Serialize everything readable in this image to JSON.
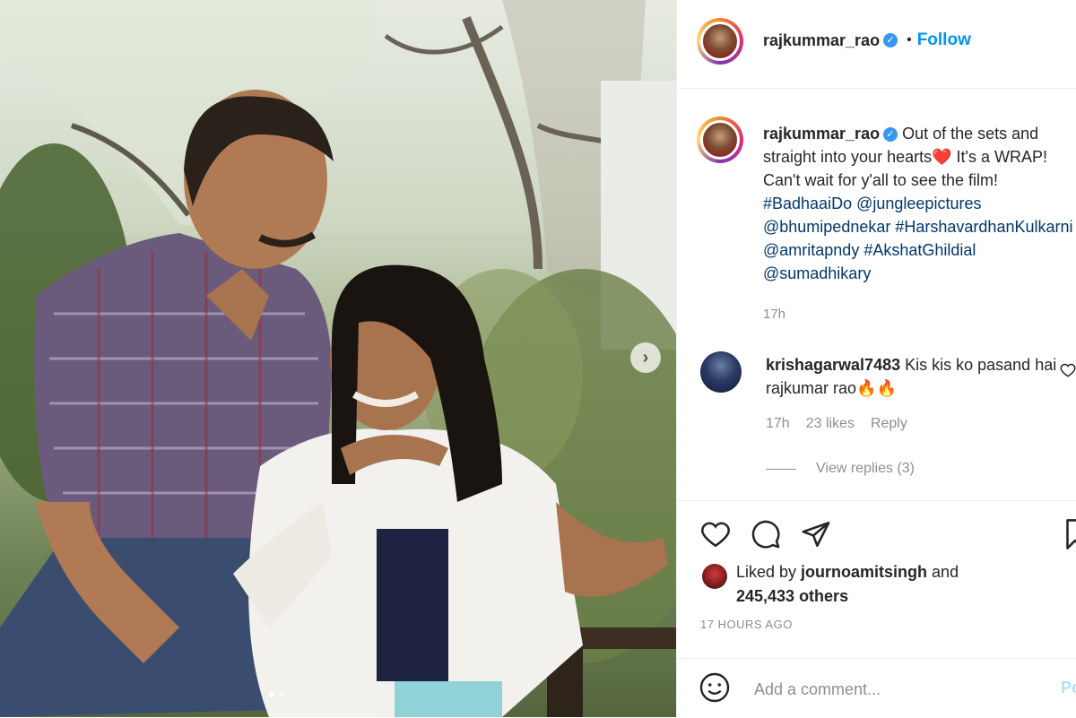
{
  "post": {
    "username": "rajkummar_rao",
    "verified_icon": "verified-badge-icon",
    "follow_label": "Follow",
    "separator": "•"
  },
  "caption": {
    "username": "rajkummar_rao",
    "text_1": "Out of the sets and straight into your hearts",
    "heart_emoji": "❤️",
    "text_2": " It's a WRAP! Can't wait for y'all to see the film! ",
    "hashtag_1": "#BadhaaiDo",
    "mention_1": "@jungleepictures",
    "mention_2": "@bhumipednekar",
    "hashtag_2": "#HarshavardhanKulkarni",
    "mention_3": "@amritapndy",
    "hashtag_3": "#AkshatGhildial",
    "mention_4": "@sumadhikary",
    "time": "17h"
  },
  "comment": {
    "username": "krishagarwal7483",
    "text": "Kis kis ko pasand hai rajkumar rao🔥🔥",
    "time": "17h",
    "likes": "23 likes",
    "reply_label": "Reply",
    "view_replies": "View replies (3)"
  },
  "likes": {
    "prefix": "Liked by ",
    "liker": "journoamitsingh",
    "middle": " and ",
    "count": "245,433 others"
  },
  "timestamp": "17 HOURS AGO",
  "add_comment": {
    "placeholder": "Add a comment...",
    "post_label": "Po"
  },
  "carousel": {
    "total_slides": 2,
    "current_slide": 1
  },
  "colors": {
    "link": "#00376b",
    "follow": "#0095f6",
    "verified": "#3897f0",
    "muted": "#8e8e8e"
  }
}
